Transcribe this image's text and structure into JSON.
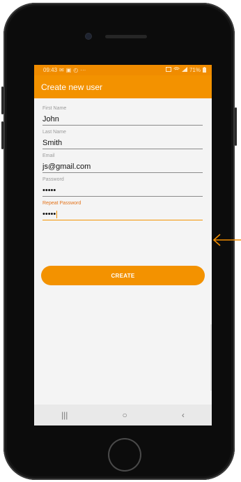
{
  "status_bar": {
    "time": "09:43",
    "notification_icons": [
      "✉",
      "▣",
      "◴"
    ],
    "more": "···",
    "battery": "71%"
  },
  "app_bar": {
    "title": "Create new user"
  },
  "form": {
    "first_name": {
      "label": "First Name",
      "value": "John"
    },
    "last_name": {
      "label": "Last Name",
      "value": "Smith"
    },
    "email": {
      "label": "Email",
      "value": "js@gmail.com"
    },
    "password": {
      "label": "Password",
      "value": "•••••"
    },
    "repeat_password": {
      "label": "Repeat Password",
      "value": "•••••"
    }
  },
  "create_button": {
    "label": "CREATE"
  },
  "nav_bar": {
    "recents": "|||",
    "home": "○",
    "back": "‹"
  },
  "colors": {
    "accent": "#f39200",
    "status_bar": "#f08c00",
    "active_label": "#e3731a"
  }
}
